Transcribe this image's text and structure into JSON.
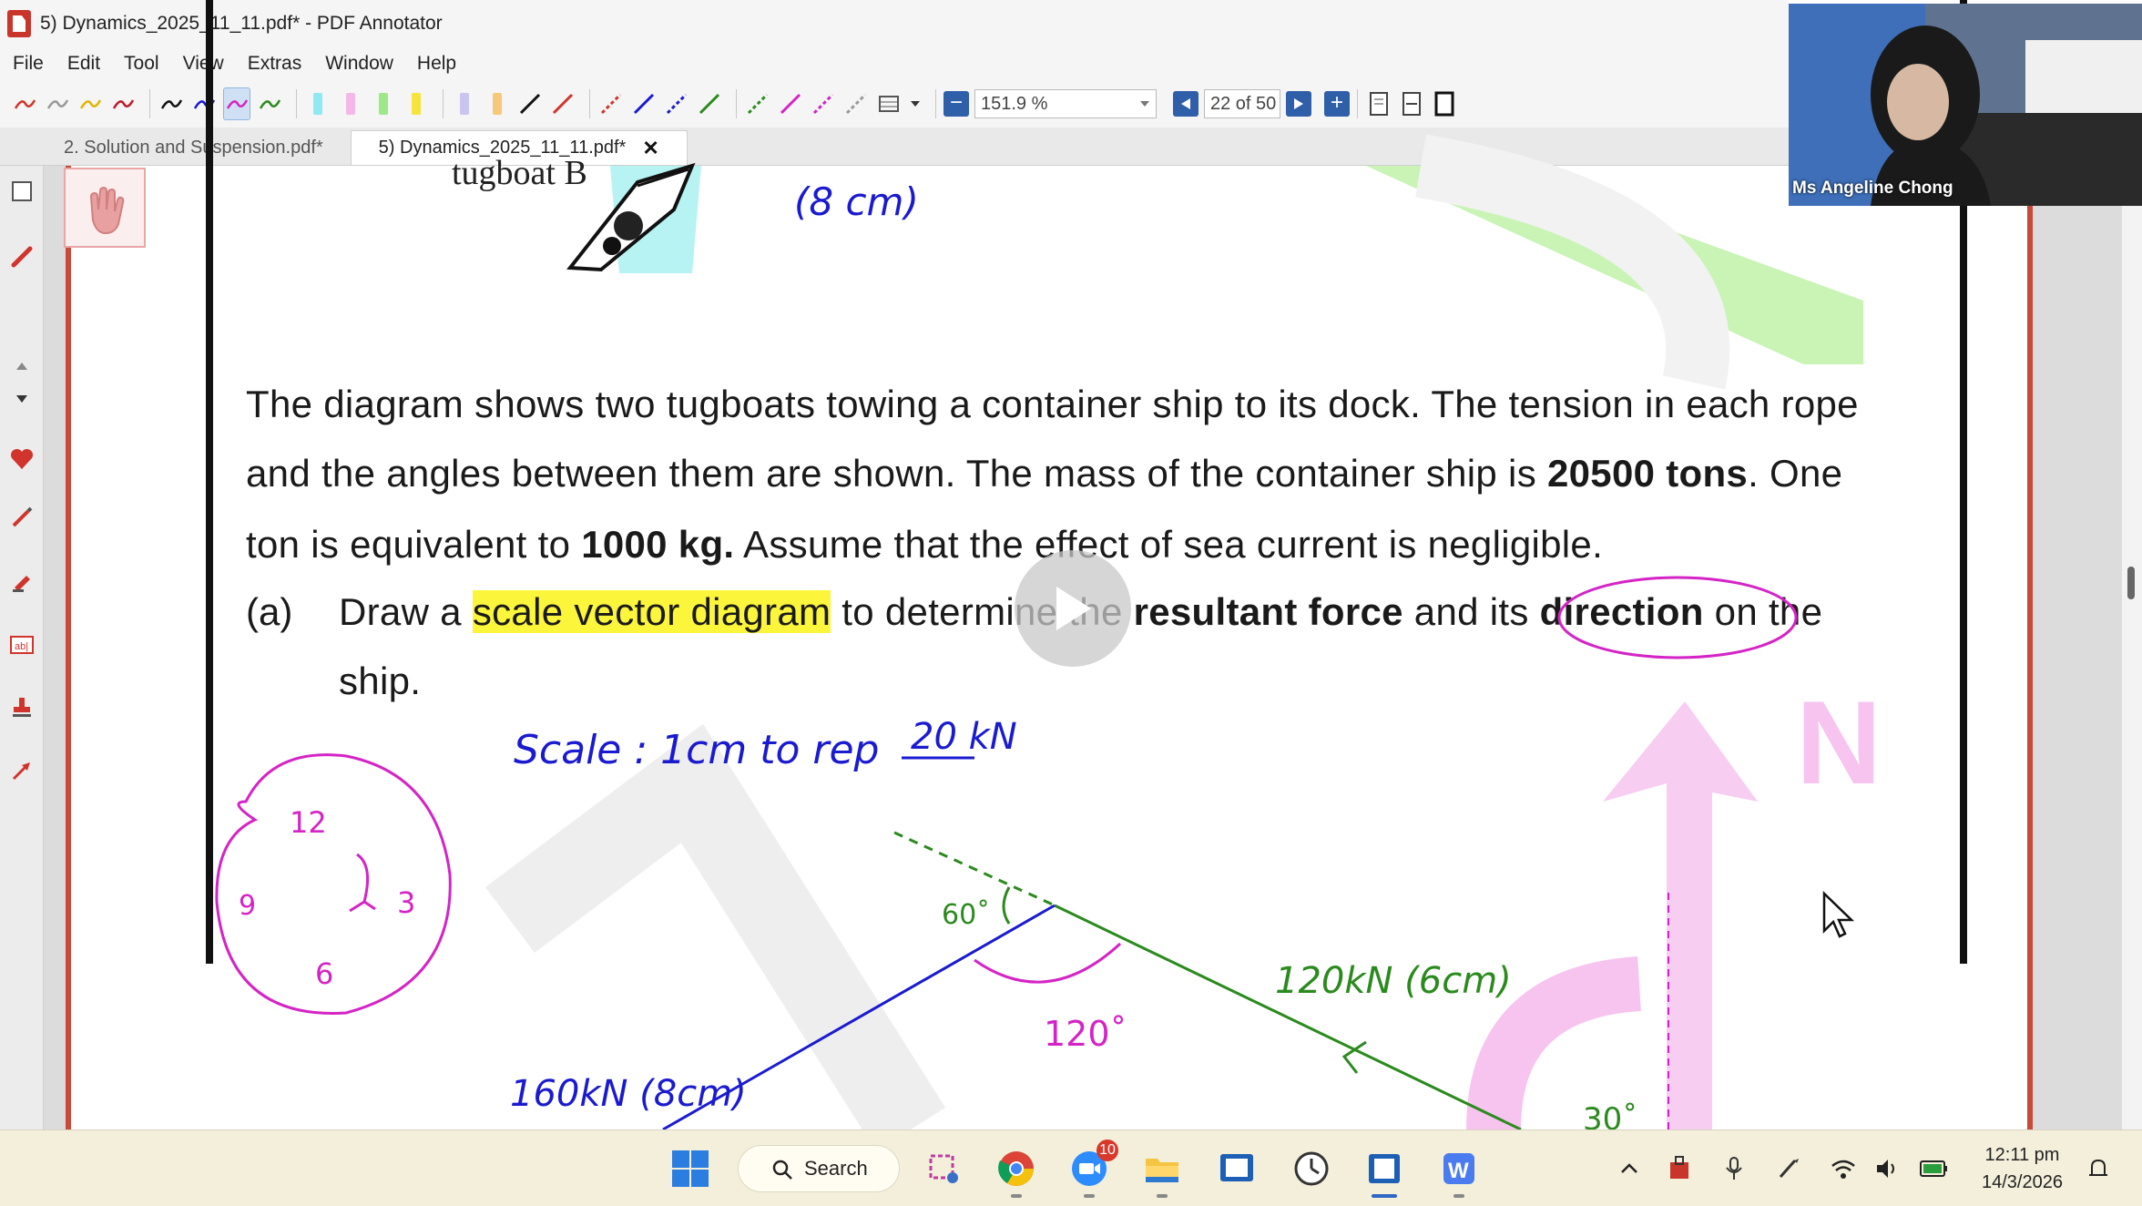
{
  "window": {
    "title": "5) Dynamics_2025_11_11.pdf* - PDF Annotator"
  },
  "menu": {
    "items": [
      {
        "label": "File"
      },
      {
        "label": "Edit"
      },
      {
        "label": "Tool"
      },
      {
        "label": "View"
      },
      {
        "label": "Extras"
      },
      {
        "label": "Window"
      },
      {
        "label": "Help"
      }
    ]
  },
  "toolbar": {
    "zoom_value": "151.9 %",
    "page_indicator": "22 of 50",
    "minus_label": "−",
    "plus_label": "+"
  },
  "tabs": [
    {
      "label": "2. Solution and Suspension.pdf*"
    },
    {
      "label": "5) Dynamics_2025_11_11.pdf*"
    }
  ],
  "tab_close_label": "✕",
  "document": {
    "tugboat_label": "tugboat B",
    "para_line1": "The diagram shows two tugboats towing a container ship to its dock. The tension in each rope",
    "para_line2_a": "and the angles between them are shown. The mass of the container ship is ",
    "para_line2_b": "20500 tons",
    "para_line2_c": ". One",
    "para_line3_a": "ton is equivalent to ",
    "para_line3_b": "1000 kg.",
    "para_line3_c": " Assume that the effect of sea current is negligible.",
    "q_label": "(a)",
    "q_a1": "Draw a ",
    "q_a_hl": "scale vector diagram",
    "q_a2": " to determine the ",
    "q_a_b1": "resultant force",
    "q_a3": " and its ",
    "q_a_b2": "direction",
    "q_a4": " on the",
    "q_line2": "ship."
  },
  "handwriting": {
    "top_note": "(8 cm)",
    "scale_note": "Scale : 1cm to rep",
    "scale_value": "20 kN",
    "clock_12": "12",
    "clock_3": "3",
    "clock_9": "9",
    "clock_6": "6",
    "angle_60": "60˚",
    "angle_120": "120˚",
    "vec_green": "120kN (6cm)",
    "vec_blue": "160kN (8cm)",
    "angle_30": "30˚",
    "north": "N"
  },
  "webcam": {
    "name": "Ms Angeline Chong"
  },
  "taskbar": {
    "search_label": "Search",
    "zoom_badge": "10",
    "time": "12:11 pm",
    "date": "14/3/2026"
  },
  "colors": {
    "pen_blue": "#1a1ad0",
    "pen_green": "#2b8a1e",
    "pen_magenta": "#d424c6",
    "highlight_yellow": "#fbf53c",
    "accent_blue": "#2f5fa8",
    "page_frame_red": "#c84a3a"
  }
}
